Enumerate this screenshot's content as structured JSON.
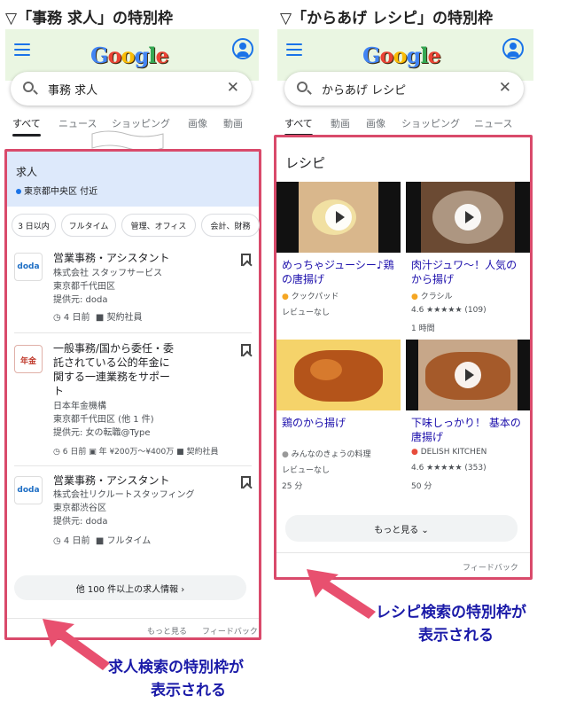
{
  "left": {
    "heading": "▽「事務 求人」の特別枠",
    "query": "事務 求人",
    "tabs": [
      "すべて",
      "ニュース",
      "ショッピング",
      "画像",
      "動画"
    ],
    "card": {
      "title": "求人",
      "location": "東京都中央区 付近"
    },
    "chips": [
      "3 日以内",
      "フルタイム",
      "管理、オフィス",
      "会計、財務"
    ],
    "jobs": [
      {
        "logo": "doda",
        "title": "営業事務・アシスタント",
        "company": "株式会社 スタッフサービス",
        "place": "東京都千代田区",
        "via": "提供元: doda",
        "age": "4 日前",
        "type": "契約社員"
      },
      {
        "logo": "年金",
        "title": "一般事務/国から委任・委託されている公的年金に関する一連業務をサポート",
        "title_lines": [
          "一般事務/国から委任・委",
          "託されている公的年金に",
          "関する一連業務をサポー",
          "ト"
        ],
        "company": "日本年金機構",
        "place": "東京都千代田区 (他 1 件)",
        "via": "提供元: 女の転職@Type",
        "age": "6 日前",
        "salary": "年 ¥200万～¥400万",
        "type": "契約社員"
      },
      {
        "logo": "doda",
        "title": "営業事務・アシスタント",
        "company": "株式会社リクルートスタッフィング",
        "place": "東京都渋谷区",
        "via": "提供元: doda",
        "age": "4 日前",
        "type": "フルタイム"
      }
    ],
    "more": "他 100 件以上の求人情報 ›",
    "show_more": "もっと見る",
    "feedback": "フィードバック",
    "callout": [
      "求人検索の特別枠が",
      "表示される"
    ]
  },
  "right": {
    "heading": "▽「からあげ レシピ」の特別枠",
    "query": "からあげ レシピ",
    "tabs": [
      "すべて",
      "動画",
      "画像",
      "ショッピング",
      "ニュース"
    ],
    "card_title": "レシピ",
    "recipes": [
      {
        "title": "めっちゃジューシー♪鶏の唐揚げ",
        "title_lines": [
          "めっちゃジューシー♪鶏",
          "の唐揚げ"
        ],
        "source": "クックパッド",
        "rating": "レビューなし",
        "time": ""
      },
      {
        "title": "肉汁ジュワ～！人気のから揚げ",
        "title_lines": [
          "肉汁ジュワ～！人気の",
          "から揚げ"
        ],
        "source": "クラシル",
        "rating": "4.6 ★★★★★ (109)",
        "time": "1 時間"
      },
      {
        "title": "鶏のから揚げ",
        "title_lines": [
          "鶏のから揚げ"
        ],
        "source": "みんなのきょうの料理",
        "rating": "レビューなし",
        "time": "25 分"
      },
      {
        "title": "下味しっかり！ 基本の唐揚げ",
        "title_lines": [
          "下味しっかり！ 基本の",
          "唐揚げ"
        ],
        "source": "DELISH KITCHEN",
        "rating": "4.6 ★★★★★ (353)",
        "time": "50 分"
      }
    ],
    "more": "もっと見る ⌄",
    "feedback": "フィードバック",
    "callout": [
      "レシピ検索の特別枠が",
      "表示される"
    ]
  },
  "logo_text": "Google",
  "colors": {
    "frame": "#d94a6b",
    "arrow": "#e8506f",
    "callout": "#1a1aa8",
    "link": "#1a0dab",
    "topbar": "#eaf6e2"
  }
}
